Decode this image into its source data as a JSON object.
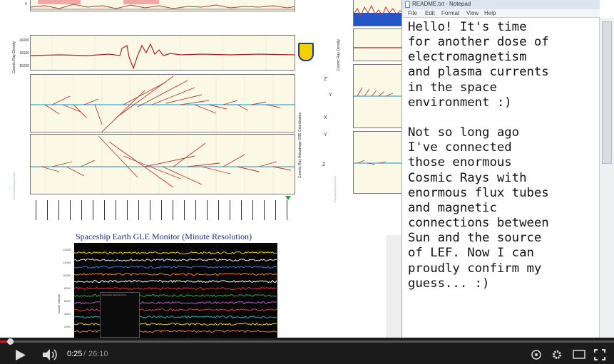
{
  "video": {
    "left_chart": {
      "y_labels": [
        "Cosmic Ray Density",
        "Cosmic Ray Anisotropy GSE Coordinates"
      ],
      "ticks": [
        "16000",
        "15600",
        "15200"
      ],
      "axis_letters": [
        "Z",
        "Y",
        "X",
        "Y",
        "Z"
      ]
    },
    "gle": {
      "title": "Spaceship Earth GLE Monitor (Minute Resolution)",
      "y_ticks": [
        "14000",
        "12000",
        "10000",
        "8000",
        "6000",
        "4000",
        "2000"
      ],
      "y_label": "counts / minute",
      "legend_title": "Spaceship Earth Monitors",
      "series_colors": [
        "#f0d21a",
        "#e8e8e8",
        "#3a7bd5",
        "#ff7a1a",
        "#ffffff",
        "#e03333",
        "#33aa33",
        "#c84dd6",
        "#d44444",
        "#2bb0b0",
        "#f0d21a",
        "#e08050"
      ]
    },
    "right_chart": {
      "y_labels": [
        "Cosmic Ray Density"
      ]
    }
  },
  "notepad": {
    "title": "README.txt - Notepad",
    "menu": [
      "File",
      "Edit",
      "Format",
      "View",
      "Help"
    ],
    "text": "Hello! It's time\nfor another dose of\nelectromagnetism\nand plasma currents\nin the space\nenvironment :)\n\nNot so long ago\nI've connected\nthose enormous\nCosmic Rays with\nenormous flux tubes\nand magnetic\nconnections between\nSun and the source\nof LEF. Now I can\nproudly confirm my\nguess... :)"
  },
  "player": {
    "current_time": "0:25",
    "separator": "/",
    "total_time": "26:10",
    "progress": 0.016,
    "colors": {
      "played": "#cc181e",
      "bar": "#1b1b1b"
    }
  }
}
